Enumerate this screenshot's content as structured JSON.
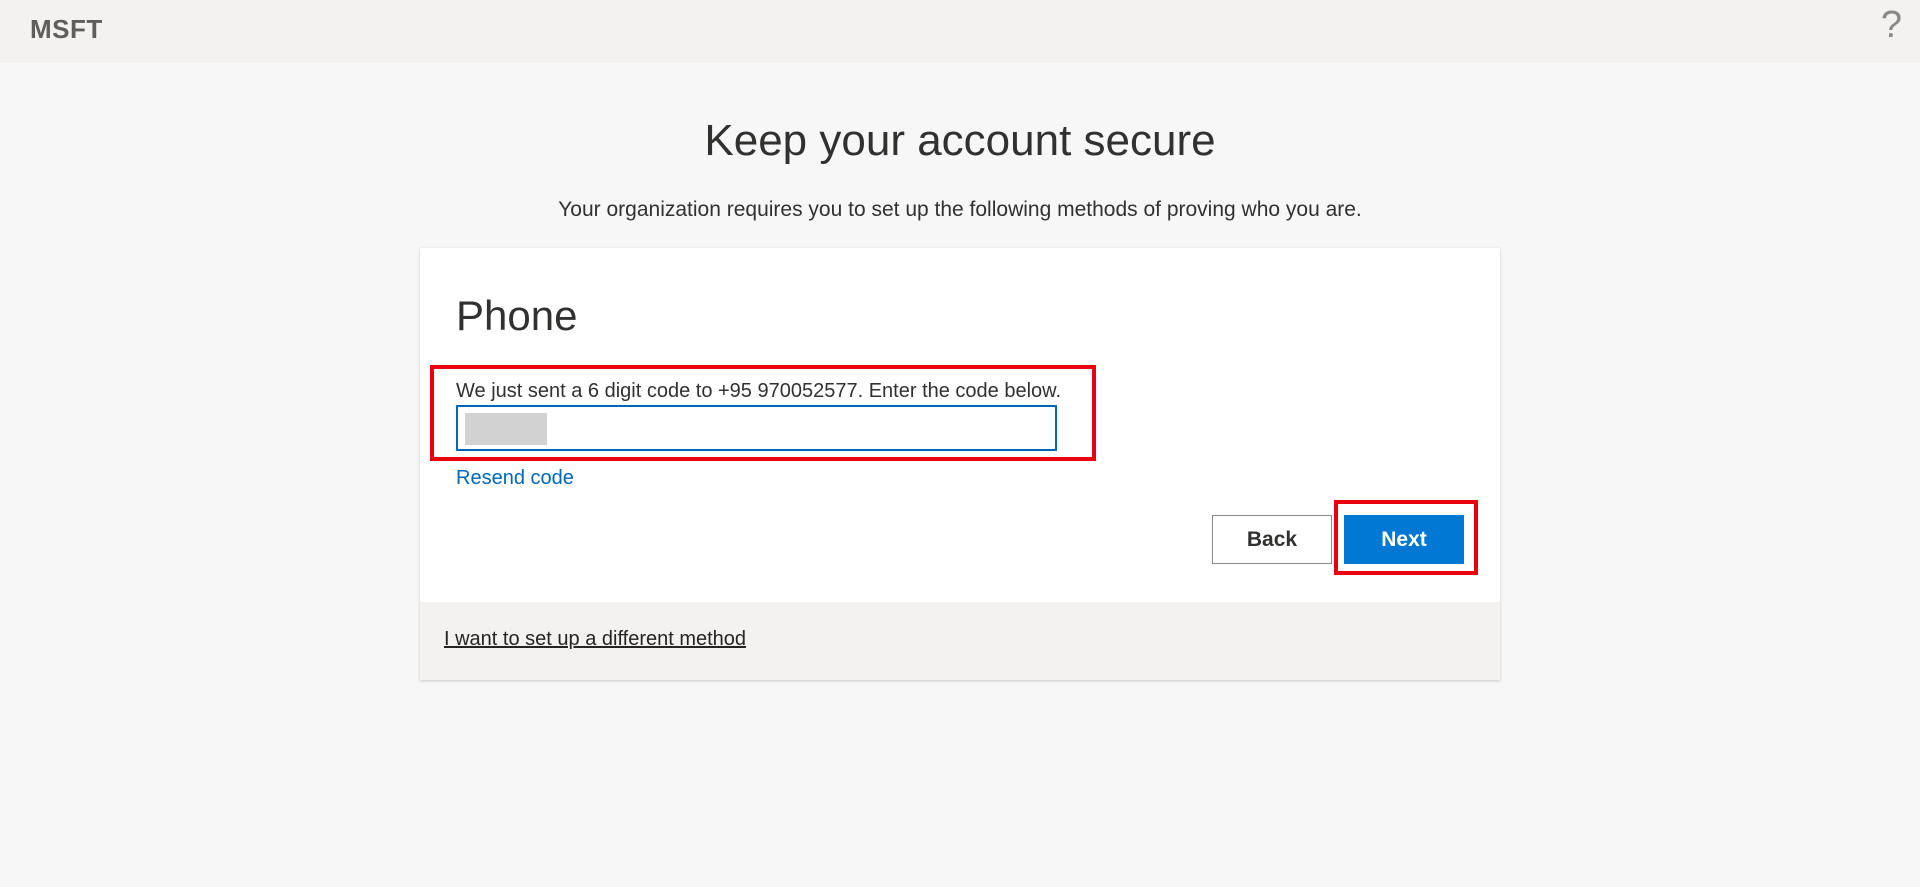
{
  "header": {
    "brand": "MSFT",
    "help_icon": "question-icon",
    "help_glyph": "?"
  },
  "page": {
    "title": "Keep your account secure",
    "subtitle": "Your organization requires you to set up the following methods of proving who you are."
  },
  "card": {
    "title": "Phone",
    "instruction": "We just sent a 6 digit code to +95 970052577. Enter the code below.",
    "code_input_value": "",
    "resend_label": "Resend code",
    "back_label": "Back",
    "next_label": "Next",
    "footer_link": "I want to set up a different method"
  },
  "colors": {
    "accent": "#0078d4",
    "link": "#0067b8",
    "highlight": "#e8000d"
  }
}
